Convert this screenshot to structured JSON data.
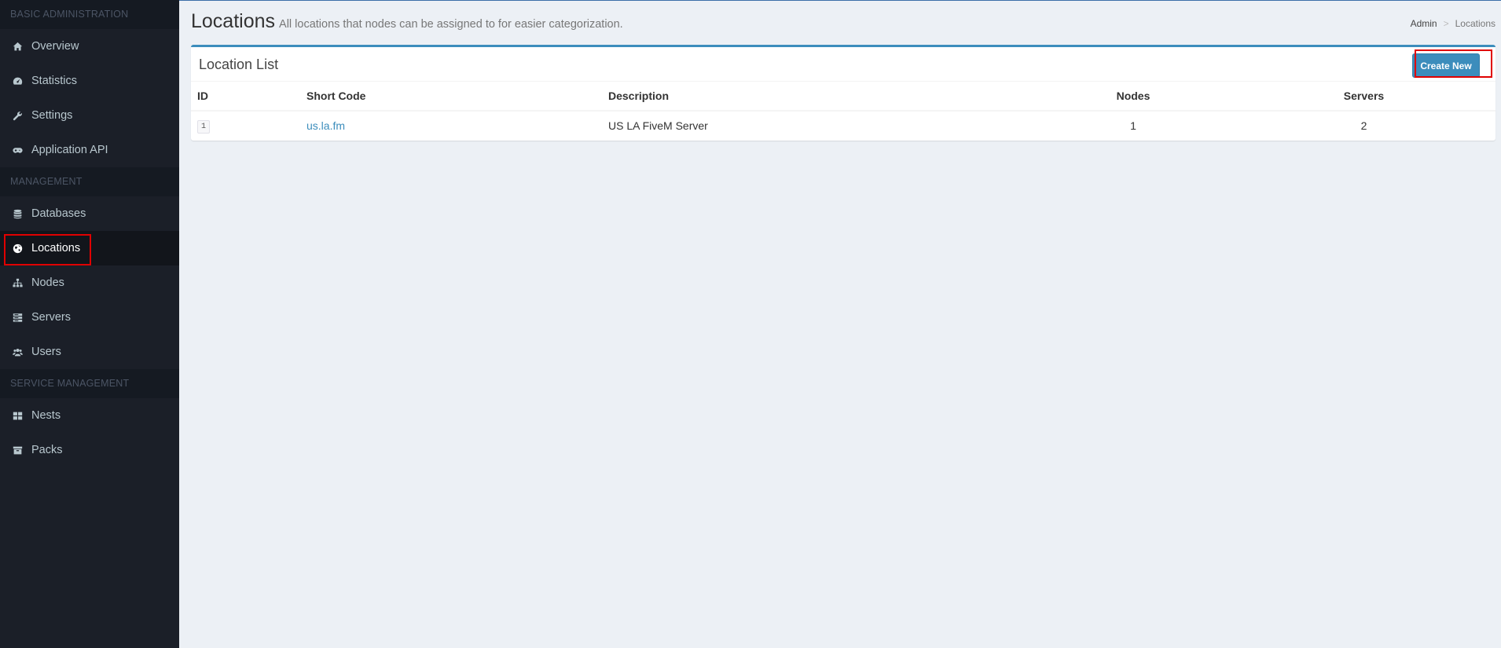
{
  "sidebar": {
    "sections": [
      {
        "header": "BASIC ADMINISTRATION",
        "items": [
          {
            "label": "Overview",
            "icon": "home-icon"
          },
          {
            "label": "Statistics",
            "icon": "dashboard-icon"
          },
          {
            "label": "Settings",
            "icon": "wrench-icon"
          },
          {
            "label": "Application API",
            "icon": "gamepad-icon"
          }
        ]
      },
      {
        "header": "MANAGEMENT",
        "items": [
          {
            "label": "Databases",
            "icon": "database-icon"
          },
          {
            "label": "Locations",
            "icon": "globe-icon",
            "active": true
          },
          {
            "label": "Nodes",
            "icon": "sitemap-icon"
          },
          {
            "label": "Servers",
            "icon": "server-icon"
          },
          {
            "label": "Users",
            "icon": "users-icon"
          }
        ]
      },
      {
        "header": "SERVICE MANAGEMENT",
        "items": [
          {
            "label": "Nests",
            "icon": "th-large-icon"
          },
          {
            "label": "Packs",
            "icon": "archive-icon"
          }
        ]
      }
    ]
  },
  "header": {
    "title": "Locations",
    "subtitle": "All locations that nodes can be assigned to for easier categorization."
  },
  "breadcrumb": {
    "root": "Admin",
    "separator": ">",
    "current": "Locations"
  },
  "box": {
    "title": "Location List",
    "create_label": "Create New"
  },
  "table": {
    "headers": {
      "id": "ID",
      "short_code": "Short Code",
      "description": "Description",
      "nodes": "Nodes",
      "servers": "Servers"
    },
    "rows": [
      {
        "id": "1",
        "short_code": "us.la.fm",
        "description": "US LA FiveM Server",
        "nodes": "1",
        "servers": "2"
      }
    ]
  },
  "colors": {
    "sidebar_bg": "#1b1f28",
    "accent": "#3c8dbc",
    "highlight": "#e00000"
  }
}
